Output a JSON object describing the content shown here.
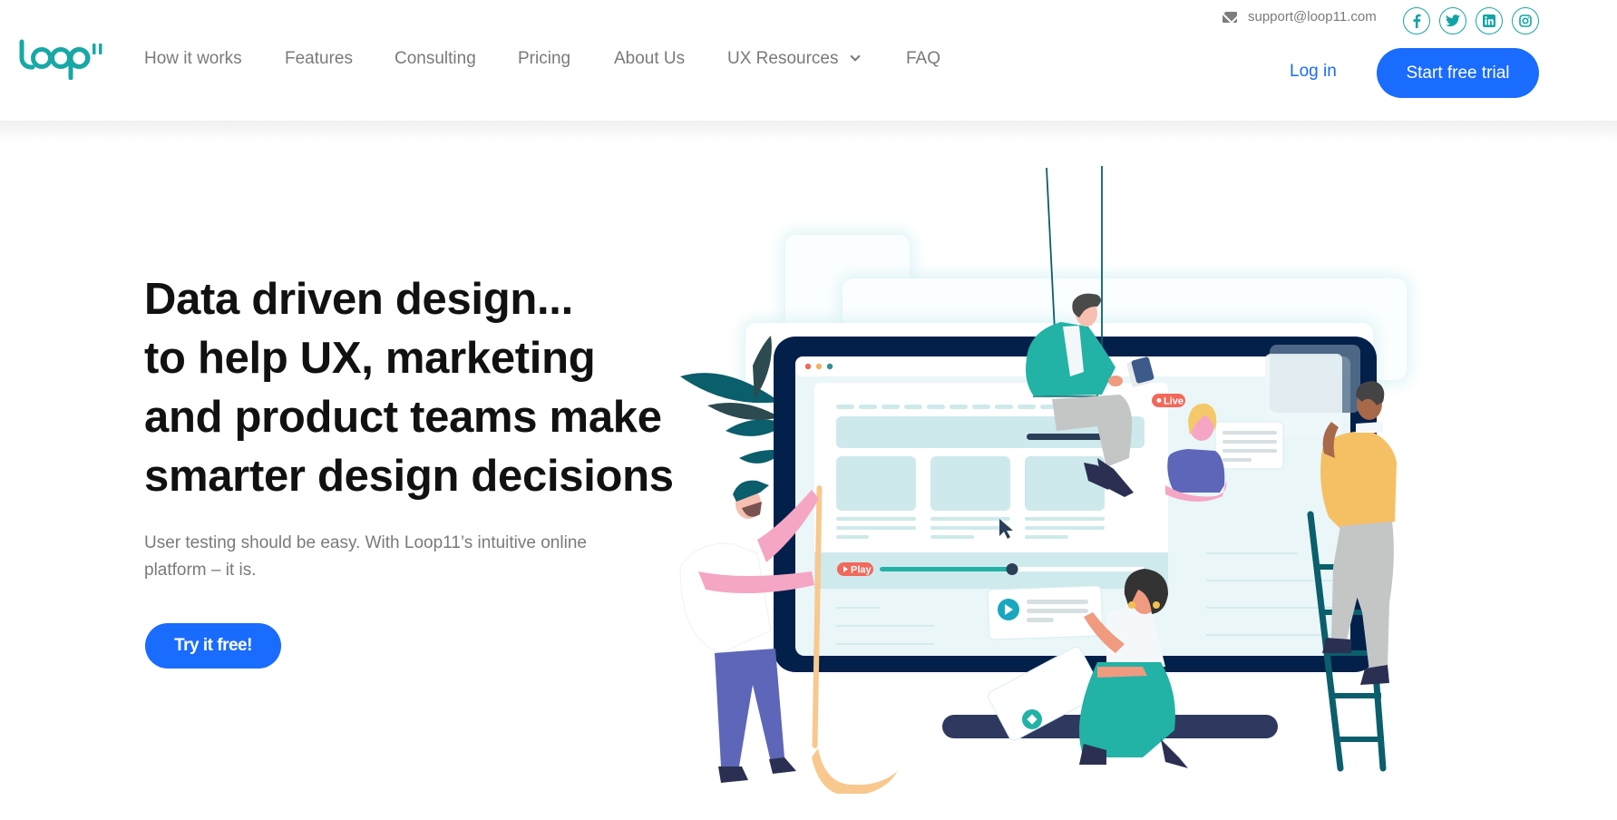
{
  "brand": {
    "name": "loop11",
    "logo_text": "loop",
    "logo_sup": "11",
    "color": "#17a8a6"
  },
  "topbar": {
    "email": "support@loop11.com",
    "social": [
      {
        "name": "facebook",
        "glyph": "f"
      },
      {
        "name": "twitter",
        "glyph": "twitter"
      },
      {
        "name": "linkedin",
        "glyph": "in"
      },
      {
        "name": "instagram",
        "glyph": "instagram"
      }
    ]
  },
  "nav": {
    "items": [
      {
        "label": "How it works"
      },
      {
        "label": "Features"
      },
      {
        "label": "Consulting"
      },
      {
        "label": "Pricing"
      },
      {
        "label": "About Us"
      },
      {
        "label": "UX Resources",
        "has_dropdown": true
      },
      {
        "label": "FAQ"
      }
    ],
    "login_label": "Log in",
    "cta_label": "Start free trial"
  },
  "hero": {
    "title_lines": [
      "Data driven design...",
      "to help UX, marketing",
      "and product teams make",
      "smarter design decisions"
    ],
    "subtitle": "User testing should be easy. With Loop11’s intuitive online platform – it is.",
    "cta_label": "Try it free!"
  },
  "illustration": {
    "live_badge": "Live",
    "play_badge": "Play",
    "video_progress": 0.5
  },
  "colors": {
    "primary_blue": "#1a6bff",
    "teal": "#17a8a6",
    "nav_text": "#7a7a7a",
    "heading": "#111111",
    "monitor_frame": "#03204a"
  }
}
